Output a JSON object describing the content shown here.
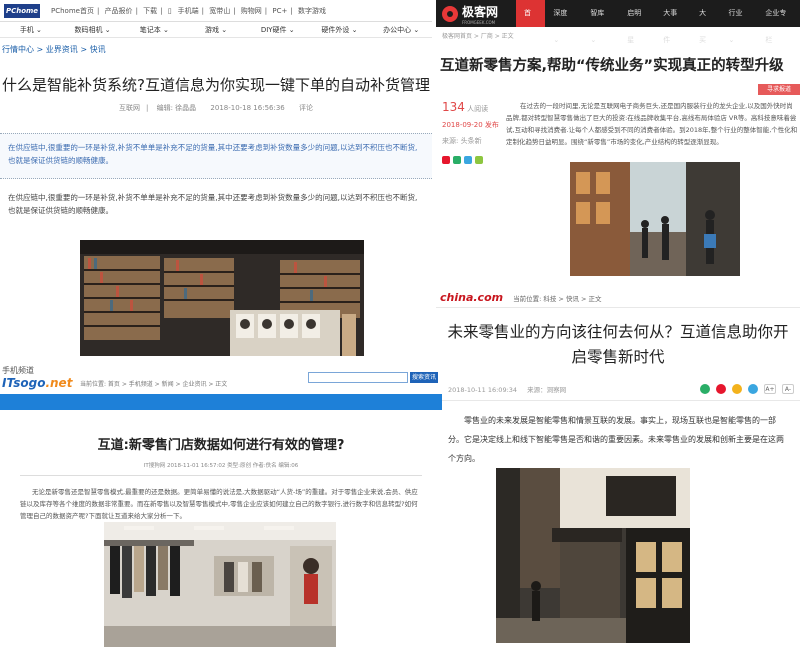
{
  "pchome": {
    "logo": "PChome",
    "top_links": [
      "PChome首页",
      "产品报价",
      "下载",
      "手机端",
      "宽带山",
      "购物网",
      "PC+",
      "数字游戏"
    ],
    "nav": [
      "手机",
      "数码相机",
      "笔记本",
      "游戏",
      "DIY硬件",
      "硬件外设",
      "办公中心"
    ],
    "breadcrumb": [
      "行情中心",
      "业界资讯",
      "快讯"
    ],
    "title": "什么是智能补货系统?互道信息为你实现一键下单的自动补货管理",
    "source": "互联网",
    "editor": "编辑: 徐晶晶",
    "date": "2018-10-18 16:56:36",
    "comment": "评论",
    "lead": "在供应链中,很重要的一环是补货,补货不单单是补充不足的货量,其中还要考虑到补货数量多少的问题,以达到不积压也不断货,也就是保证供货链的顺畅健康。",
    "body": "在供应链中,很重要的一环是补货,补货不单单是补充不足的货量,其中还要考虑到补货数量多少的问题,以达到不积压也不断货,也就是保证供货链的顺畅健康。"
  },
  "jikewang": {
    "brand": "极客网",
    "brand_sub": "FROMGEEK.COM",
    "nav": [
      "首页",
      "深度",
      "智库",
      "启明星",
      "大事件",
      "大买",
      "行业",
      "企业专栏"
    ],
    "breadcrumb": "极客网首页 > 厂商 > 正文",
    "title": "互道新零售方案,帮助“传统业务”实现真正的转型升级",
    "tag": "寻求报道",
    "views": "134",
    "views_label": "人阅读",
    "date": "2018-09-20",
    "date_suffix": "发布",
    "source": "来源: 头条新",
    "body": "在过去的一段时间里,无论是互联网电子商务巨头,还是国内服装行业的龙头企业,以及国外快时尚品牌,都对转型智慧零售做出了巨大的投资:在线品牌收集平台,高线布局体验店 VR等。高科技意味着尝试,互动和寻找消费者.让每个人都感受到不同的消费者体验。到2018年,整个行业的整体智能,个性化和定制化趋势日益明显。围绕“新零售”市场的变化,产业结构的转型逐渐显现。"
  },
  "chinacom": {
    "brand": "china.com",
    "breadcrumb": "当前位置: 科技 > 快讯 > 正文",
    "title": "未来零售业的方向该往何去何从？互道信息助你开启零售新时代",
    "date": "2018-10-11 16:09:34",
    "source": "来源：洞察网",
    "font_up": "A+",
    "font_down": "A-",
    "body": "零售业的未来发展是智能零售和情景互联的发展。事实上，现场互联也是智能零售的一部分。它是决定线上和线下智能零售是否和谐的重要因素。未来零售业的发展和创新主要是在这两个方向。"
  },
  "itsogo": {
    "logo_top": "手机频道",
    "logo_main": "ITsogo",
    "logo_suffix": ".net",
    "breadcrumb": "当前位置: 首页 > 手机频道 > 新闻 > 企业资讯 > 正文",
    "search_button": "搜索资讯",
    "title": "互道:新零售门店数据如何进行有效的管理?",
    "meta": "IT搜狗网 2018-11-01 16:57:02 类型:原创 作者:佚名 编辑:06",
    "body": "无论是新零售还是智慧零售模式,最重要的还是数据。更简单易懂的说法是,大数据驱动“人货-场”的重建。对于零售企业来说,会员、供应链以及库存等各个维度的数据非常重要。而在新零售以及智慧零售模式中,零售企业应该如何建立自己的数字银行,进行数字和信息转型?如何管理自己的数据资产呢?下面就让互道来给大家分析一下。"
  },
  "colors": {
    "pchome_blue": "#1e3f8a",
    "jike_red": "#d33333",
    "china_red": "#c8161e",
    "itsogo_blue": "#1e80d8"
  }
}
